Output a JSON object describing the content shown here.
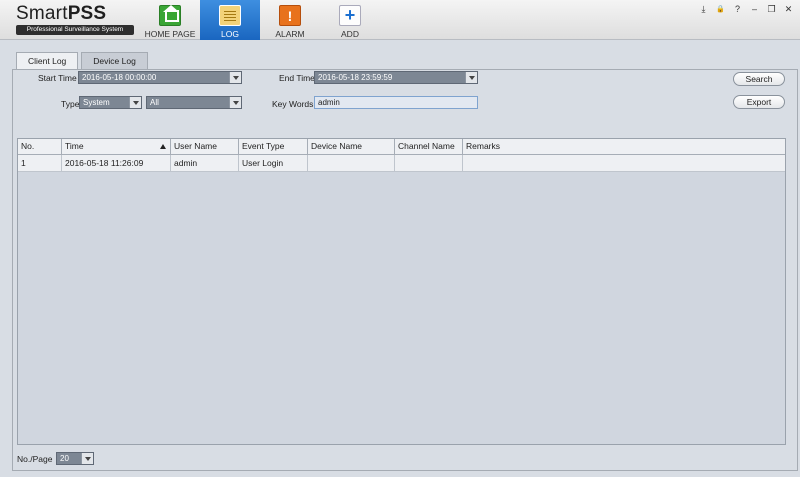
{
  "app": {
    "logo_title_light": "Smart",
    "logo_title_bold": "PSS",
    "logo_subtitle": "Professional Surveillance System"
  },
  "nav": {
    "home": "HOME PAGE",
    "log": "LOG",
    "alarm": "ALARM",
    "add": "ADD"
  },
  "window_controls": {
    "download": "⤓",
    "lock": "🔒",
    "help": "?",
    "minimize": "–",
    "restore": "❐",
    "close": "✕"
  },
  "tabs": {
    "client_log": "Client Log",
    "device_log": "Device Log"
  },
  "filters": {
    "start_time_label": "Start Time",
    "start_time_value": "2016-05-18 00:00:00",
    "end_time_label": "End Time",
    "end_time_value": "2016-05-18 23:59:59",
    "type_label": "Type",
    "type_value": "System",
    "subtype_value": "All",
    "keywords_label": "Key Words",
    "keywords_value": "admin",
    "search_button": "Search",
    "export_button": "Export"
  },
  "table": {
    "columns": [
      "No.",
      "Time",
      "User Name",
      "Event Type",
      "Device Name",
      "Channel Name",
      "Remarks"
    ],
    "rows": [
      [
        "1",
        "2016-05-18 11:26:09",
        "admin",
        "User Login",
        "",
        "",
        ""
      ]
    ]
  },
  "pager": {
    "label": "No./Page",
    "value": "20"
  },
  "colors": {
    "nav_active": "#2a7ad4",
    "log_icon": "#f3d37a",
    "home_icon": "#3aa535",
    "alarm_icon": "#e8721c",
    "combo_bg": "#7d8794"
  }
}
